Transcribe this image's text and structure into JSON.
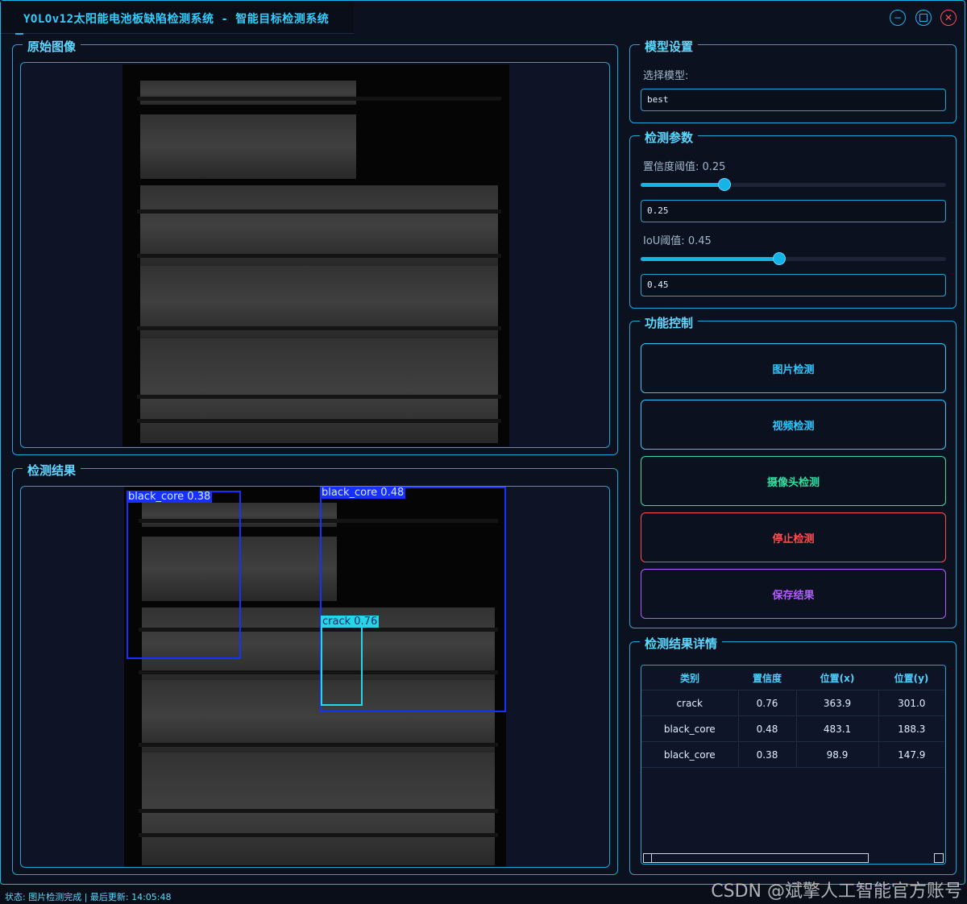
{
  "window": {
    "title": "YOLOv12太阳能电池板缺陷检测系统 - 智能目标检测系统",
    "minimize_glyph": "−",
    "maximize_glyph": "☐",
    "close_glyph": "✕"
  },
  "panels": {
    "original_title": "原始图像",
    "result_title": "检测结果"
  },
  "detections_overlay": [
    {
      "label": "black_core 0.38",
      "color": "#1530ff"
    },
    {
      "label": "black_core 0.48",
      "color": "#1530ff"
    },
    {
      "label": "crack 0.76",
      "color": "#27d6e6"
    }
  ],
  "model_settings": {
    "title": "模型设置",
    "select_label": "选择模型:",
    "model_value": "best"
  },
  "detect_params": {
    "title": "检测参数",
    "conf_label": "置信度阈值: 0.25",
    "conf_value": "0.25",
    "conf_fraction": 0.25,
    "iou_label": "IoU阈值: 0.45",
    "iou_value": "0.45",
    "iou_fraction": 0.45
  },
  "function_control": {
    "title": "功能控制",
    "buttons": [
      {
        "label": "图片检测",
        "color": "#2fc8ff"
      },
      {
        "label": "视频检测",
        "color": "#2fc8ff"
      },
      {
        "label": "摄像头检测",
        "color": "#2fe0a0"
      },
      {
        "label": "停止检测",
        "color": "#ff4d4d"
      },
      {
        "label": "保存结果",
        "color": "#b45cff"
      }
    ]
  },
  "result_details": {
    "title": "检测结果详情",
    "columns": [
      "类别",
      "置信度",
      "位置(x)",
      "位置(y)"
    ],
    "rows": [
      [
        "crack",
        "0.76",
        "363.9",
        "301.0"
      ],
      [
        "black_core",
        "0.48",
        "483.1",
        "188.3"
      ],
      [
        "black_core",
        "0.38",
        "98.9",
        "147.9"
      ]
    ]
  },
  "status_bar": {
    "text": "状态: 图片检测完成 | 最后更新: 14:05:48"
  },
  "watermark": "CSDN @斌擎人工智能官方账号"
}
